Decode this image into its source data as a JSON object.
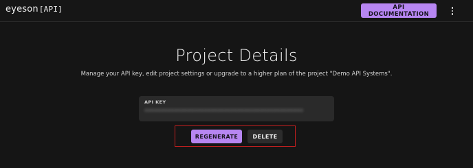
{
  "header": {
    "logo_text": "eyeson",
    "logo_bracket": "[API]",
    "doc_button_label": "API DOCUMENTATION",
    "menu_icon": "kebab-menu-icon"
  },
  "main": {
    "title": "Project Details",
    "subtitle": "Manage your API key, edit project settings or upgrade to a higher plan of the project \"Demo API Systems\".",
    "api_key_label": "API KEY",
    "api_key_value": "••••••••••••••••••••••••••••••••••••••••••••••••",
    "regenerate_label": "REGENERATE",
    "delete_label": "DELETE"
  },
  "colors": {
    "accent": "#b786f2",
    "background": "#151515",
    "highlight": "#c41f1f"
  }
}
